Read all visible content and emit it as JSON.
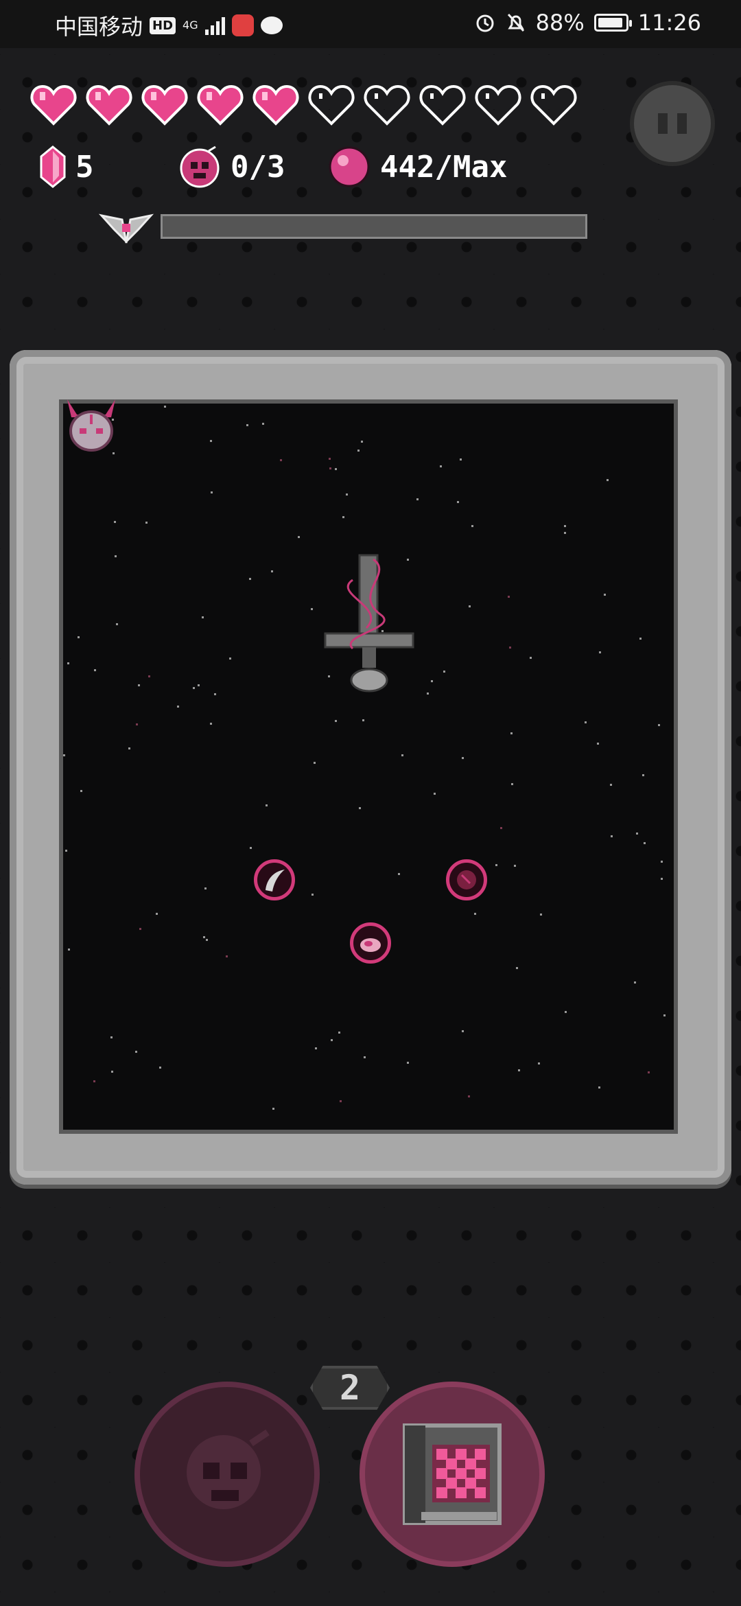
{
  "status_bar": {
    "carrier": "中国移动",
    "hd": "HD",
    "network": "4G",
    "battery": "88%",
    "time": "11:26",
    "icons": [
      "alarm-icon",
      "mute-bell-icon",
      "battery-icon"
    ]
  },
  "hud": {
    "hearts": {
      "filled": 5,
      "total": 10,
      "colors": {
        "filled": "#e8458c",
        "outline": "#ffffff"
      }
    },
    "gems": "5",
    "bombs": "0/3",
    "souls": "442/Max",
    "boss_health_fraction": 0.0
  },
  "arena": {
    "pickups": [
      "horn-pickup",
      "red-orb-pickup",
      "meat-pickup"
    ]
  },
  "abilities": {
    "counter": "2",
    "skull_ability": "skull-bomb",
    "rune_ability": "rune-chest"
  },
  "colors": {
    "accent": "#e8458c",
    "background": "#1c1c1e",
    "stone": "#a8a8a8"
  }
}
